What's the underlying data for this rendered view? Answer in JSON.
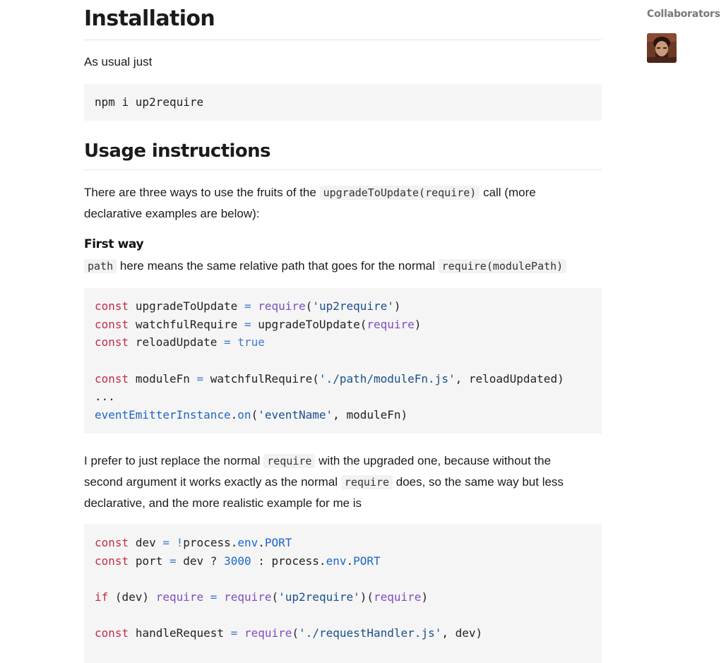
{
  "install": {
    "heading": "Installation",
    "text": "As usual just",
    "command": "npm i up2require"
  },
  "usage": {
    "heading": "Usage instructions",
    "intro_before": "There are three ways to use the fruits of the",
    "intro_code": "upgradeToUpdate(require)",
    "intro_after": "call (more declarative examples are below):"
  },
  "first_way": {
    "heading": "First way",
    "path_code": "path",
    "desc_middle": "here means the same relative path that goes for the normal",
    "desc_code": "require(modulePath)"
  },
  "code1": {
    "l1": [
      "const",
      "upgradeToUpdate",
      "=",
      "require",
      "(",
      "'up2require'",
      ")"
    ],
    "l2": [
      "const",
      "watchfulRequire",
      "=",
      "upgradeToUpdate(",
      "require",
      ")"
    ],
    "l3": [
      "const",
      "reloadUpdate",
      "=",
      "true"
    ],
    "l4": [
      "const",
      "moduleFn",
      "=",
      "watchfulRequire(",
      "'./path/moduleFn.js'",
      ", reloadUpdated)"
    ],
    "l5": "...",
    "l6": [
      "eventEmitterInstance",
      ".",
      "on",
      "(",
      "'eventName'",
      ", moduleFn)"
    ]
  },
  "pref": {
    "t1": "I prefer to just replace the normal",
    "c1": "require",
    "t2": "with the upgraded one, because without the second argument it works exactly as the normal",
    "c2": "require",
    "t3": "does, so the same way but less declarative, and the more realistic example for me is"
  },
  "code2": {
    "l1": [
      "const",
      "dev",
      "=",
      "!",
      "process.",
      "env",
      ".",
      "PORT"
    ],
    "l2": [
      "const",
      "port",
      "=",
      "dev ? ",
      "3000",
      " : process.",
      "env",
      ".",
      "PORT"
    ],
    "l3": [
      "if",
      " (dev) ",
      "require",
      "=",
      "require",
      "(",
      "'up2require'",
      ")(",
      "require",
      ")"
    ],
    "l4": [
      "const",
      "handleRequest",
      "=",
      "require",
      "(",
      "'./requestHandler.js'",
      ", dev)"
    ]
  },
  "sidebar": {
    "title": "Collaborators",
    "avatar_icon": "user-avatar"
  }
}
